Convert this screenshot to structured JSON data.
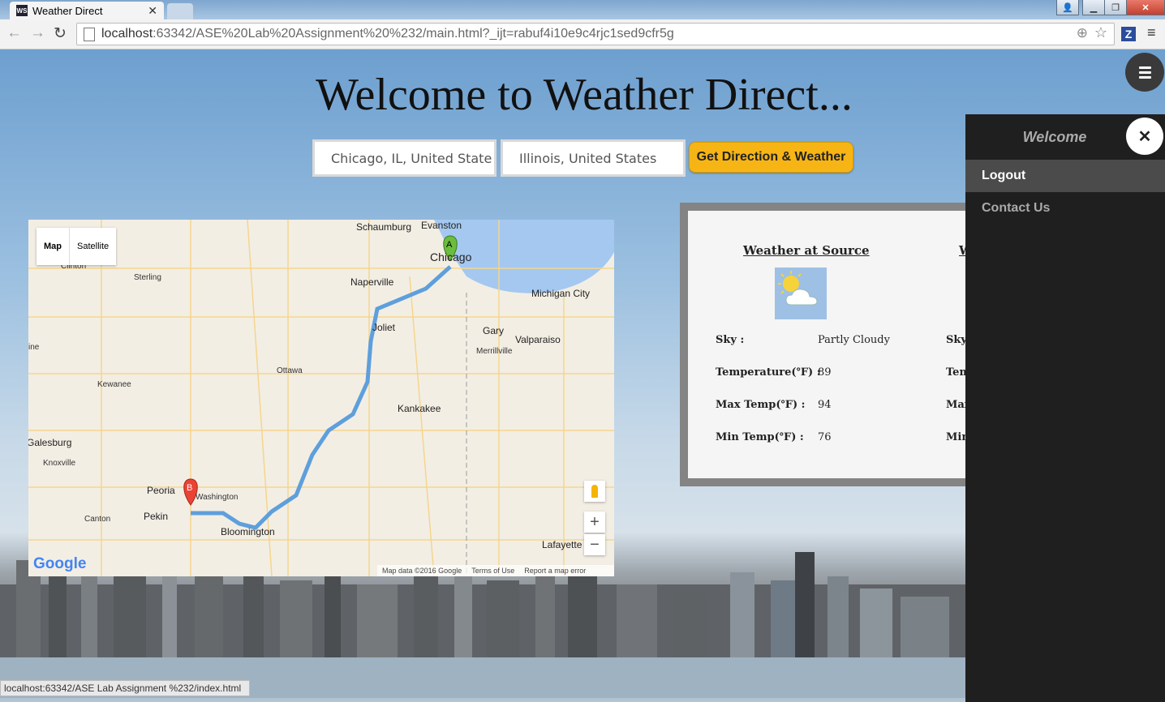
{
  "browser": {
    "tab_title": "Weather Direct",
    "tab_favicon": "WS",
    "url_host": "localhost",
    "url_rest": ":63342/ASE%20Lab%20Assignment%20%232/main.html?_ijt=rabuf4i10e9c4rjc1sed9cfr5g",
    "status_url": "localhost:63342/ASE Lab Assignment %232/index.html"
  },
  "page": {
    "title": "Welcome to Weather Direct...",
    "source_value": "Chicago, IL, United States",
    "destination_value": "Illinois, United States",
    "button_label": "Get Direction & Weather"
  },
  "map": {
    "type_map": "Map",
    "type_satellite": "Satellite",
    "marker_a": "A",
    "marker_b": "B",
    "zoom_in": "+",
    "zoom_out": "−",
    "google_logo": "Google",
    "footer_data": "Map data ©2016 Google",
    "footer_terms": "Terms of Use",
    "footer_report": "Report a map error",
    "cities": {
      "schaumburg": "Schaumburg",
      "evanston": "Evanston",
      "chicago": "Chicago",
      "clinton": "Clinton",
      "sterling": "Sterling",
      "naperville": "Naperville",
      "michigan_city": "Michigan City",
      "joliet": "Joliet",
      "gary": "Gary",
      "valparaiso": "Valparaiso",
      "merrillville": "Merrillville",
      "ottawa": "Ottawa",
      "kewanee": "Kewanee",
      "kankakee": "Kankakee",
      "galesburg": "Galesburg",
      "knoxville": "Knoxville",
      "peoria": "Peoria",
      "washington": "Washington",
      "canton": "Canton",
      "pekin": "Pekin",
      "bloomington": "Bloomington",
      "lafayette": "Lafayette",
      "ine": "ine"
    }
  },
  "weather": {
    "source_heading": "Weather at Source",
    "dest_heading_partial": "W",
    "sky_label": "Sky :",
    "sky_value": "Partly Cloudy",
    "temp_label": "Temperature(℉) :",
    "temp_value": "89",
    "max_label": "Max Temp(℉) :",
    "max_value": "94",
    "min_label": "Min Temp(℉) :",
    "min_value": "76",
    "sky_label2": "Sky",
    "temp_label2": "Tem",
    "max_label2": "Max",
    "min_label2": "Min"
  },
  "sidebar": {
    "welcome": "Welcome",
    "close": "✕",
    "logout": "Logout",
    "contact": "Contact Us"
  },
  "icons": {
    "weather": "partly-cloudy-icon",
    "menu": "hamburger-icon"
  }
}
